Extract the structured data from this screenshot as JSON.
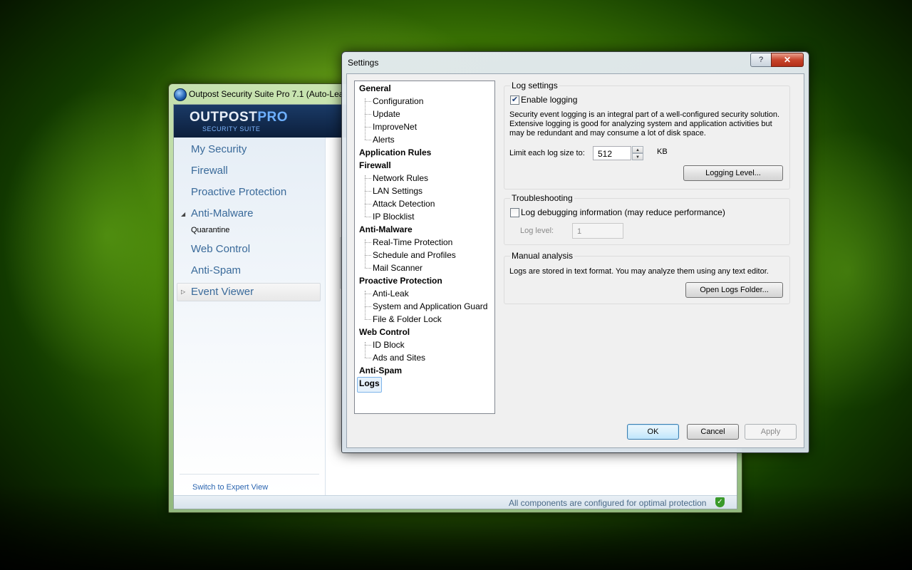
{
  "main_window": {
    "title": "Outpost Security Suite Pro 7.1 (Auto-Lea",
    "brand": {
      "logo_main": "OUTPOST",
      "logo_pro": "PRO",
      "logo_sub": "SECURITY SUITE"
    },
    "nav": [
      {
        "label": "My Security"
      },
      {
        "label": "Firewall"
      },
      {
        "label": "Proactive Protection"
      },
      {
        "label": "Anti-Malware"
      },
      {
        "label": "Quarantine"
      },
      {
        "label": "Web Control"
      },
      {
        "label": "Anti-Spam"
      },
      {
        "label": "Event Viewer"
      }
    ],
    "expert_link": "Switch to Expert View",
    "status_text": "All components are configured for optimal protection",
    "icons": {
      "app": "outpost-logo-icon",
      "status": "shield-check-icon",
      "expander": "triangle-icon"
    }
  },
  "dialog": {
    "title": "Settings",
    "help_label": "?",
    "close_label": "✕",
    "tree": {
      "general": "General",
      "configuration": "Configuration",
      "update": "Update",
      "improvenet": "ImproveNet",
      "alerts": "Alerts",
      "application_rules": "Application Rules",
      "firewall": "Firewall",
      "network_rules": "Network Rules",
      "lan_settings": "LAN Settings",
      "attack_detection": "Attack Detection",
      "ip_blocklist": "IP Blocklist",
      "anti_malware": "Anti-Malware",
      "real_time_protection": "Real-Time Protection",
      "schedule_profiles": "Schedule and Profiles",
      "mail_scanner": "Mail Scanner",
      "proactive_protection": "Proactive Protection",
      "anti_leak": "Anti-Leak",
      "system_app_guard": "System and Application Guard",
      "file_folder_lock": "File & Folder Lock",
      "web_control": "Web Control",
      "id_block": "ID Block",
      "ads_sites": "Ads and Sites",
      "anti_spam": "Anti-Spam",
      "logs": "Logs"
    },
    "log_settings": {
      "title": "Log settings",
      "enable_logging": "Enable logging",
      "enable_logging_checked": true,
      "description_1": "Security event logging is an integral part of a well-configured security solution.",
      "description_2": "Extensive logging is good for analyzing system and application activities but",
      "description_3": "may be redundant and may consume a lot of disk space.",
      "limit_label": "Limit each log size to:",
      "limit_value": "512",
      "limit_unit": "KB",
      "logging_level_button": "Logging Level..."
    },
    "troubleshooting": {
      "title": "Troubleshooting",
      "log_debug": "Log debugging information (may reduce performance)",
      "log_debug_checked": false,
      "log_level_label": "Log level:",
      "log_level_value": "1"
    },
    "manual_analysis": {
      "title": "Manual analysis",
      "description": "Logs are stored in text format. You may analyze them using any text editor.",
      "open_folder_button": "Open Logs Folder..."
    },
    "buttons": {
      "ok": "OK",
      "cancel": "Cancel",
      "apply": "Apply"
    }
  }
}
